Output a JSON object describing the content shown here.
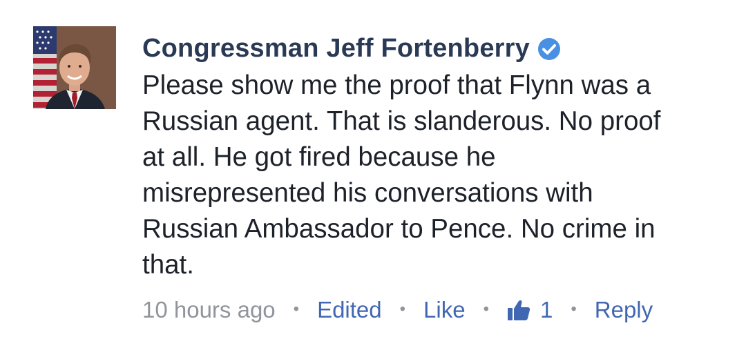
{
  "comment": {
    "author": "Congressman Jeff Fortenberry",
    "verified_icon": "verified-badge-icon",
    "body_lines": [
      "Please show me the proof that Flynn was a",
      "Russian agent. That is slanderous. No proof",
      "at all. He got fired because he",
      "misrepresented his conversations with",
      "Russian Ambassador to Pence. No crime in",
      "that."
    ],
    "timestamp": "10 hours ago",
    "separator": "•",
    "edited_label": "Edited",
    "like_label": "Like",
    "like_count": "1",
    "like_icon": "thumbs-up-icon",
    "reply_label": "Reply"
  },
  "colors": {
    "link": "#4267b2",
    "meta": "#90949c",
    "text": "#1d2129",
    "verified": "#4a90e2"
  }
}
